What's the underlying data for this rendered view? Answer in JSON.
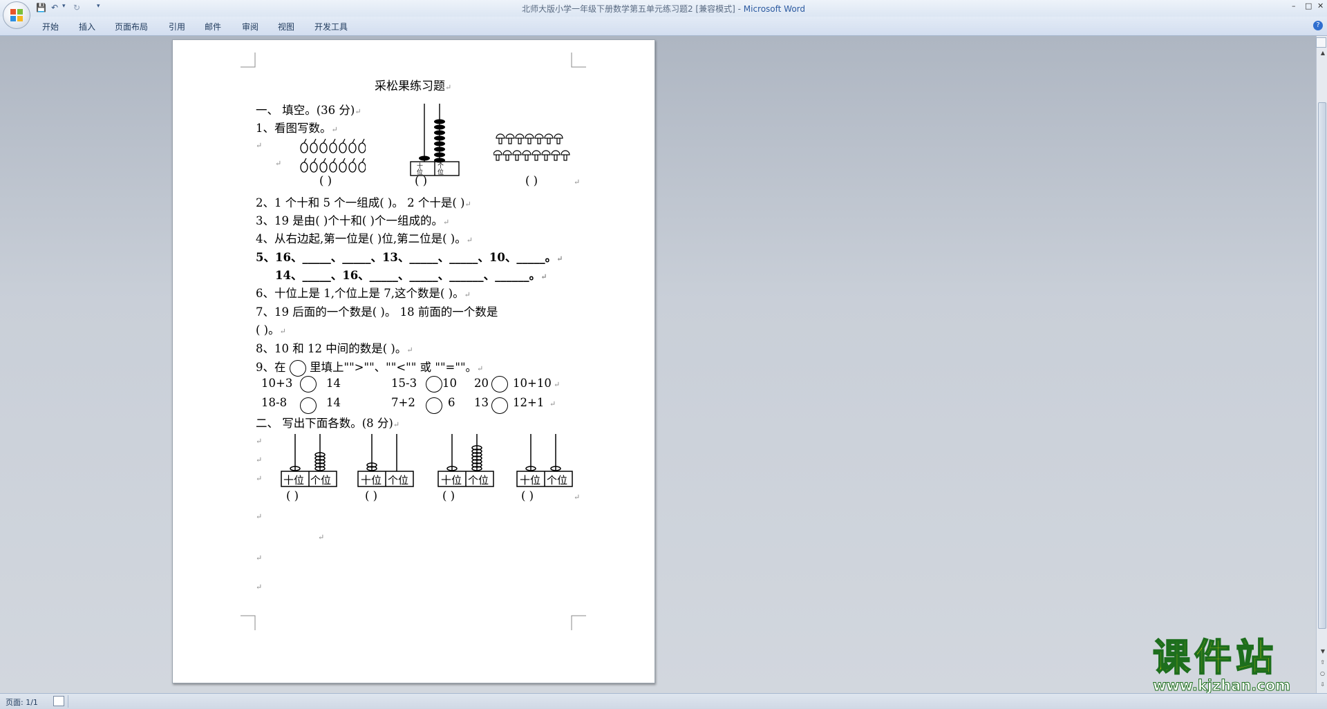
{
  "window": {
    "title": "北师大版小学一年级下册数学第五单元练习题2 [兼容模式]",
    "app": "Microsoft Word",
    "separator": " - "
  },
  "tabs": [
    "开始",
    "插入",
    "页面布局",
    "引用",
    "邮件",
    "审阅",
    "视图",
    "开发工具"
  ],
  "doc": {
    "title": "采松果练习题",
    "s1": "一、  填空。(36 分)",
    "q1": "1、看图写数。",
    "q1_blanks": [
      "(      )",
      "(      )",
      "(      )"
    ],
    "q2": "2、1 个十和 5 个一组成(      )。      2 个十是(      )",
    "q3": "3、19 是由(   )个十和(     )个一组成的。",
    "q4": "4、从右边起,第一位是(     )位,第二位是(     )。",
    "q5a": "5、16、_____、_____、13、_____、_____、10、_____。",
    "q5b": "14、_____、16、_____、_____、______、______。",
    "q6": "6、十位上是 1,个位上是 7,这个数是(       )。",
    "q7a": "7、19 后面的一个数是(     )。      18 前面的一个数是",
    "q7b": "(     )。",
    "q8": "8、10 和 12 中间的数是(       )。",
    "q9_pre": "9、在",
    "q9_post": "里填上\"\">\"\"、\"\"<\"\" 或 \"\"=\"\"。",
    "q9_r1": [
      "10+3",
      "14",
      "15-3",
      "10",
      "20",
      "10+10"
    ],
    "q9_r2": [
      "18-8",
      "14",
      "7+2",
      "6",
      "13",
      "12+1"
    ],
    "s2": "二、  写出下面各数。(8 分)",
    "abacus_tens": "十位",
    "abacus_ones": "个位",
    "abacus_beads": [
      [
        1,
        5
      ],
      [
        2,
        0
      ],
      [
        1,
        7
      ],
      [
        1,
        1
      ]
    ],
    "s2_blanks": [
      "(          )",
      "(          )",
      "(          )",
      "(          )"
    ],
    "q1_abacus_labels": [
      "十",
      "个",
      "位",
      "位"
    ]
  },
  "status": {
    "page": "页面: 1/1"
  },
  "watermark": {
    "name": "课件站",
    "url": "www.kjzhan.com"
  },
  "colors": {
    "accent": "#2c5aa0",
    "watermark_fill": "#f5e400",
    "watermark_stroke": "#1d6e1d"
  }
}
